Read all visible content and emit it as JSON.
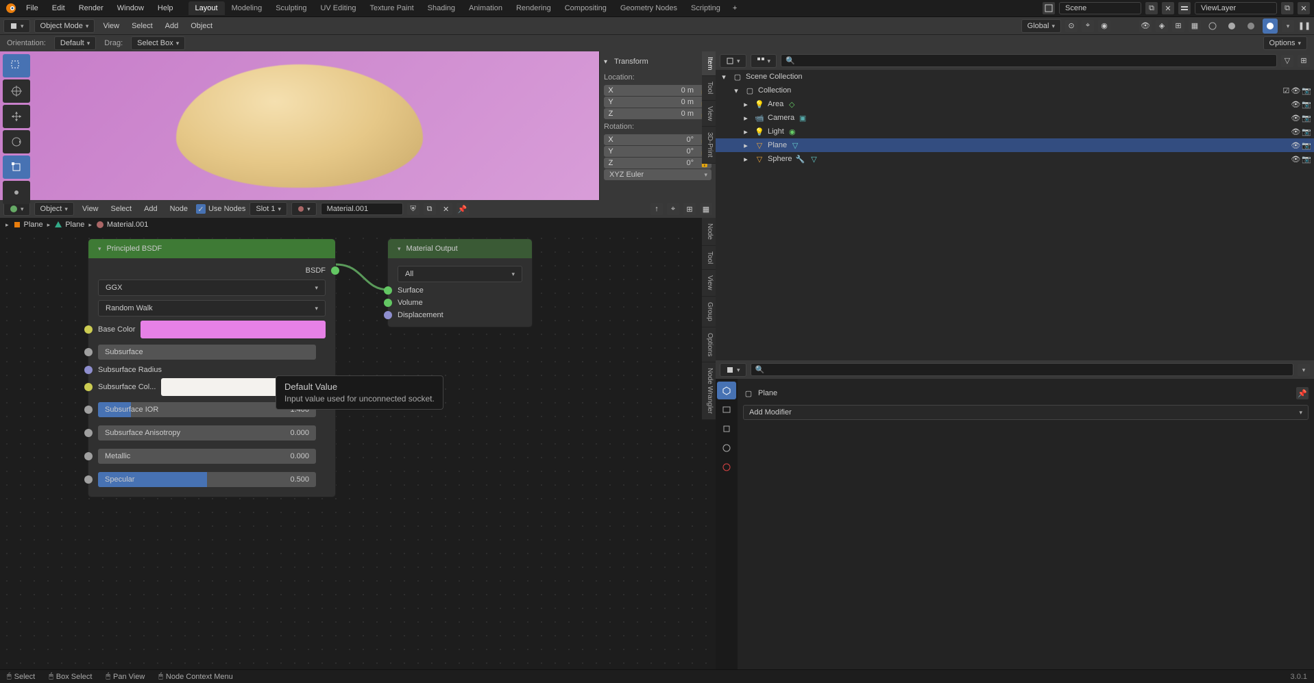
{
  "menus": [
    "File",
    "Edit",
    "Render",
    "Window",
    "Help"
  ],
  "workspaces": [
    "Layout",
    "Modeling",
    "Sculpting",
    "UV Editing",
    "Texture Paint",
    "Shading",
    "Animation",
    "Rendering",
    "Compositing",
    "Geometry Nodes",
    "Scripting"
  ],
  "active_workspace": "Layout",
  "scene_name": "Scene",
  "viewlayer_name": "ViewLayer",
  "viewport": {
    "mode": "Object Mode",
    "header_menus": [
      "View",
      "Select",
      "Add",
      "Object"
    ],
    "transform_orientation": "Global",
    "orientation_label": "Orientation:",
    "orientation_value": "Default",
    "drag_label": "Drag:",
    "drag_value": "Select Box",
    "options_label": "Options"
  },
  "transform_panel": {
    "title": "Transform",
    "location_label": "Location:",
    "location": [
      {
        "axis": "X",
        "value": "0 m"
      },
      {
        "axis": "Y",
        "value": "0 m"
      },
      {
        "axis": "Z",
        "value": "0 m"
      }
    ],
    "rotation_label": "Rotation:",
    "rotation": [
      {
        "axis": "X",
        "value": "0°"
      },
      {
        "axis": "Y",
        "value": "0°"
      },
      {
        "axis": "Z",
        "value": "0°"
      }
    ],
    "rotation_mode": "XYZ Euler"
  },
  "side_tabs_3d": [
    "Item",
    "Tool",
    "View",
    "3D-Print"
  ],
  "node_editor": {
    "mode": "Object",
    "header_menus": [
      "View",
      "Select",
      "Add",
      "Node"
    ],
    "use_nodes_label": "Use Nodes",
    "slot": "Slot 1",
    "material_name": "Material.001",
    "breadcrumb": [
      "Plane",
      "Plane",
      "Material.001"
    ]
  },
  "side_tabs_node": [
    "Node",
    "Tool",
    "View",
    "Group",
    "Options",
    "Node Wrangler"
  ],
  "nodes": {
    "principled": {
      "title": "Principled BSDF",
      "output": "BSDF",
      "dd1": "GGX",
      "dd2": "Random Walk",
      "base_color_label": "Base Color",
      "base_color": "#e681e6",
      "subsurface_label": "Subsurface",
      "subsurface_radius_label": "Subsurface Radius",
      "subsurface_color_label": "Subsurface Col...",
      "subsurface_color": "#f4f2ee",
      "subsurface_ior_label": "Subsurface IOR",
      "subsurface_ior_value": "1.400",
      "subsurface_aniso_label": "Subsurface Anisotropy",
      "subsurface_aniso_value": "0.000",
      "metallic_label": "Metallic",
      "metallic_value": "0.000",
      "specular_label": "Specular",
      "specular_value": "0.500"
    },
    "output": {
      "title": "Material Output",
      "dd": "All",
      "surface": "Surface",
      "volume": "Volume",
      "displacement": "Displacement"
    }
  },
  "tooltip": {
    "title": "Default Value",
    "body": "Input value used for unconnected socket."
  },
  "outliner": {
    "root": "Scene Collection",
    "collection": "Collection",
    "items": [
      {
        "name": "Area",
        "type": "light"
      },
      {
        "name": "Camera",
        "type": "camera"
      },
      {
        "name": "Light",
        "type": "light"
      },
      {
        "name": "Plane",
        "type": "mesh",
        "selected": true
      },
      {
        "name": "Sphere",
        "type": "mesh"
      }
    ]
  },
  "properties": {
    "context": "Plane",
    "add_modifier": "Add Modifier"
  },
  "statusbar": {
    "select": "Select",
    "box_select": "Box Select",
    "pan_view": "Pan View",
    "context_menu": "Node Context Menu",
    "version": "3.0.1"
  }
}
